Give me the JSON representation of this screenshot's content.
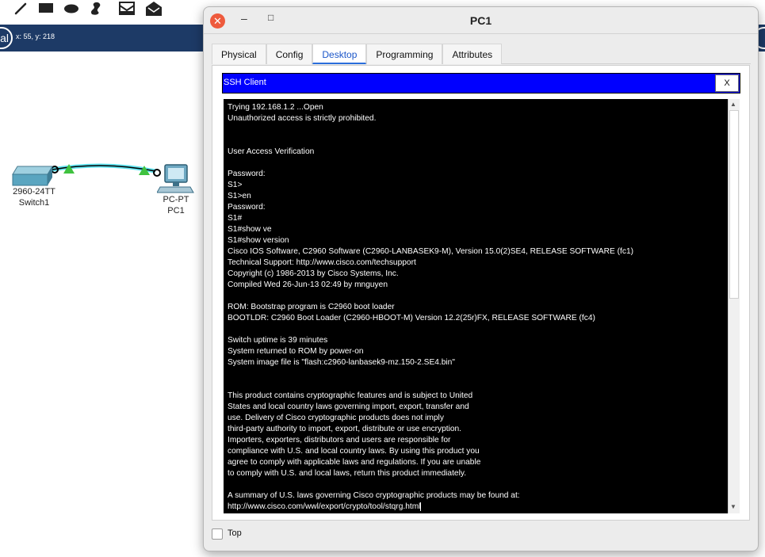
{
  "workspace": {
    "mode_label": "al",
    "coords": "x: 55, y: 218",
    "toolbar_icons": [
      "line-icon",
      "rectangle-icon",
      "ellipse-icon",
      "freeform-icon",
      "inbox-icon",
      "open-envelope-icon"
    ],
    "devices": [
      {
        "name": "switch1",
        "model": "2960-24TT",
        "label": "Switch1"
      },
      {
        "name": "pc1",
        "model": "PC-PT",
        "label": "PC1"
      }
    ],
    "link_color": "#5fe3ef",
    "link_status_color": "#3fc23f"
  },
  "window": {
    "title": "PC1",
    "tabs": [
      "Physical",
      "Config",
      "Desktop",
      "Programming",
      "Attributes"
    ],
    "active_tab": "Desktop",
    "close_icon": "close-icon",
    "minimize_symbol": "–",
    "maximize_symbol": "□"
  },
  "ssh": {
    "title": "SSH Client",
    "close_label": "X",
    "terminal_lines": [
      "Trying 192.168.1.2 ...Open",
      "Unauthorized access is strictly prohibited.",
      "",
      "",
      "User Access Verification",
      "",
      "Password:",
      "S1>",
      "S1>en",
      "Password:",
      "S1#",
      "S1#show ve",
      "S1#show version",
      "Cisco IOS Software, C2960 Software (C2960-LANBASEK9-M), Version 15.0(2)SE4, RELEASE SOFTWARE (fc1)",
      "Technical Support: http://www.cisco.com/techsupport",
      "Copyright (c) 1986-2013 by Cisco Systems, Inc.",
      "Compiled Wed 26-Jun-13 02:49 by mnguyen",
      "",
      "ROM: Bootstrap program is C2960 boot loader",
      "BOOTLDR: C2960 Boot Loader (C2960-HBOOT-M) Version 12.2(25r)FX, RELEASE SOFTWARE (fc4)",
      "",
      "Switch uptime is 39 minutes",
      "System returned to ROM by power-on",
      "System image file is \"flash:c2960-lanbasek9-mz.150-2.SE4.bin\"",
      "",
      "",
      "This product contains cryptographic features and is subject to United",
      "States and local country laws governing import, export, transfer and",
      "use. Delivery of Cisco cryptographic products does not imply",
      "third-party authority to import, export, distribute or use encryption.",
      "Importers, exporters, distributors and users are responsible for",
      "compliance with U.S. and local country laws. By using this product you",
      "agree to comply with applicable laws and regulations. If you are unable",
      "to comply with U.S. and local laws, return this product immediately.",
      "",
      "A summary of U.S. laws governing Cisco cryptographic products may be found at:",
      "http://www.cisco.com/wwl/export/crypto/tool/stqrg.html"
    ]
  },
  "footer": {
    "top_label": "Top",
    "top_checked": false
  }
}
